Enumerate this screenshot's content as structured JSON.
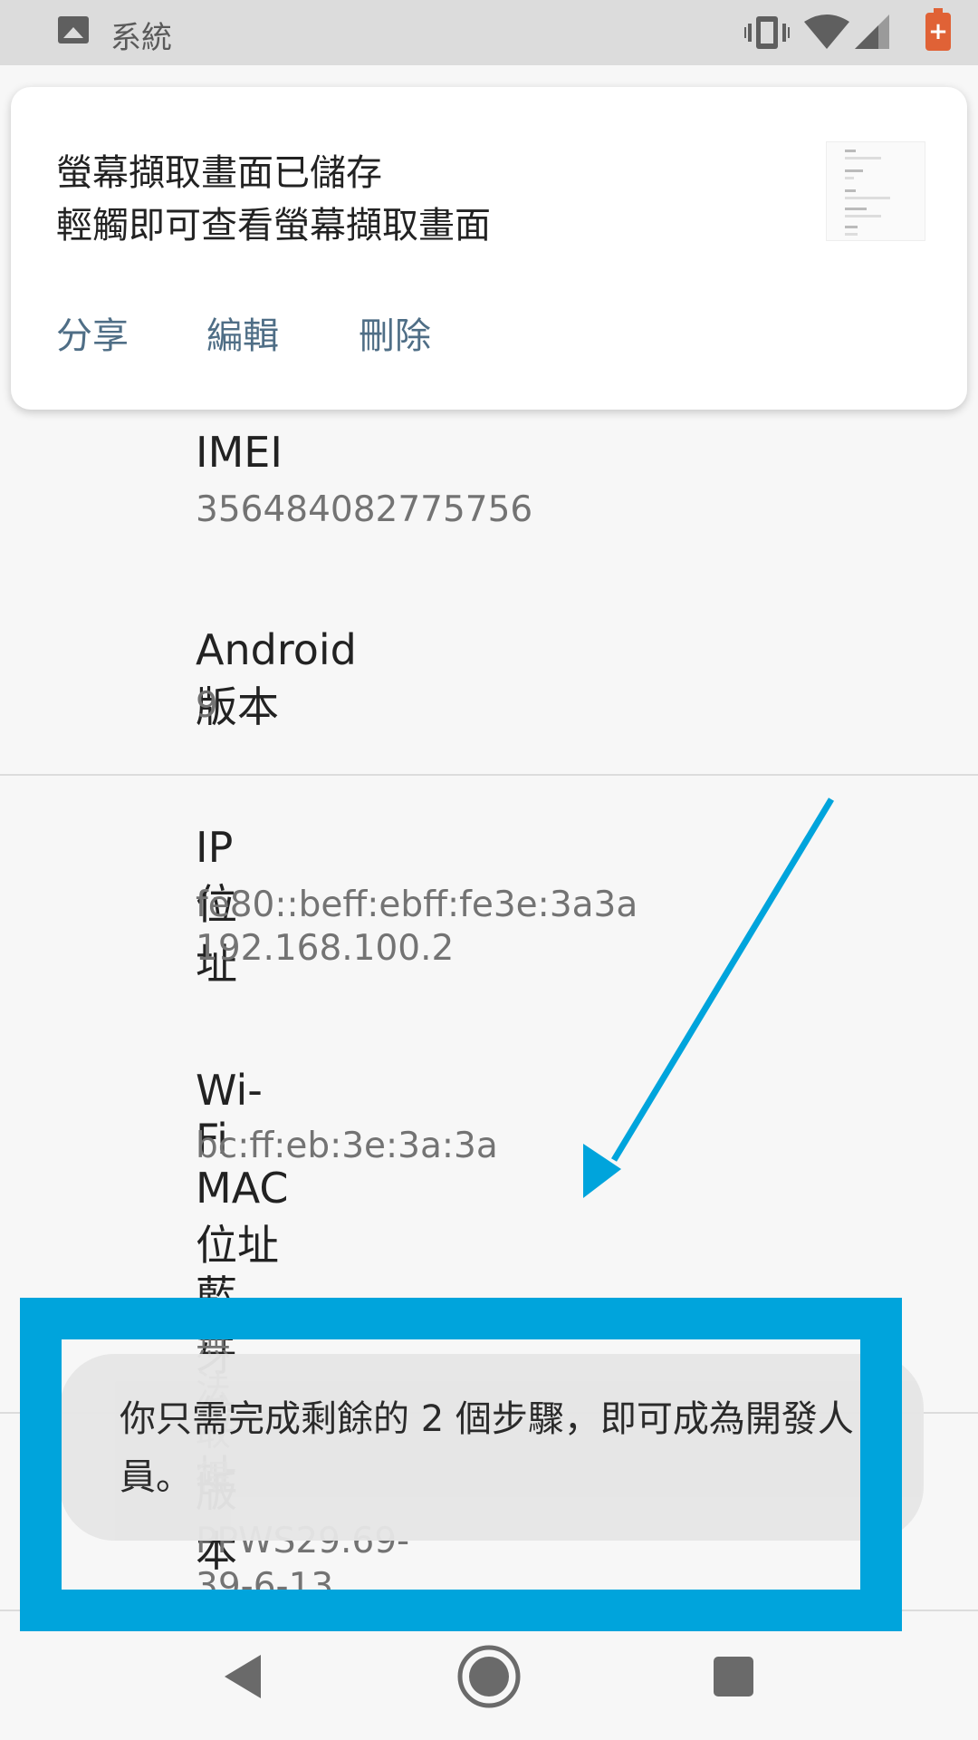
{
  "status_bar": {
    "app_label": "系統",
    "accent_color": "#e06236"
  },
  "notification": {
    "line1": "螢幕擷取畫面已儲存",
    "line2": "輕觸即可查看螢幕擷取畫面",
    "actions": [
      "分享",
      "編輯",
      "刪除"
    ]
  },
  "rows": [
    {
      "title": "IMEI",
      "values": [
        "356484082775756"
      ]
    },
    {
      "title": "Android 版本",
      "values": [
        "9"
      ]
    },
    {
      "title": "IP 位址",
      "values": [
        "fe80::beff:ebff:fe3e:3a3a",
        "192.168.100.2"
      ]
    },
    {
      "title": "Wi-Fi MAC 位址",
      "values": [
        "bc:ff:eb:3e:3a:3a"
      ]
    },
    {
      "title": "藍牙位址",
      "values": [
        "無法取得"
      ]
    },
    {
      "title": "版本號碼",
      "values": [
        "PPWS29.69-39-6-13"
      ]
    }
  ],
  "toast": {
    "message": "你只需完成剩餘的 2 個步驟，即可成為開發人員。"
  },
  "annotation": {
    "color": "#00a4dc"
  },
  "nav": {
    "back_icon": "back-icon",
    "home_icon": "home-icon",
    "recents_icon": "recents-icon"
  }
}
